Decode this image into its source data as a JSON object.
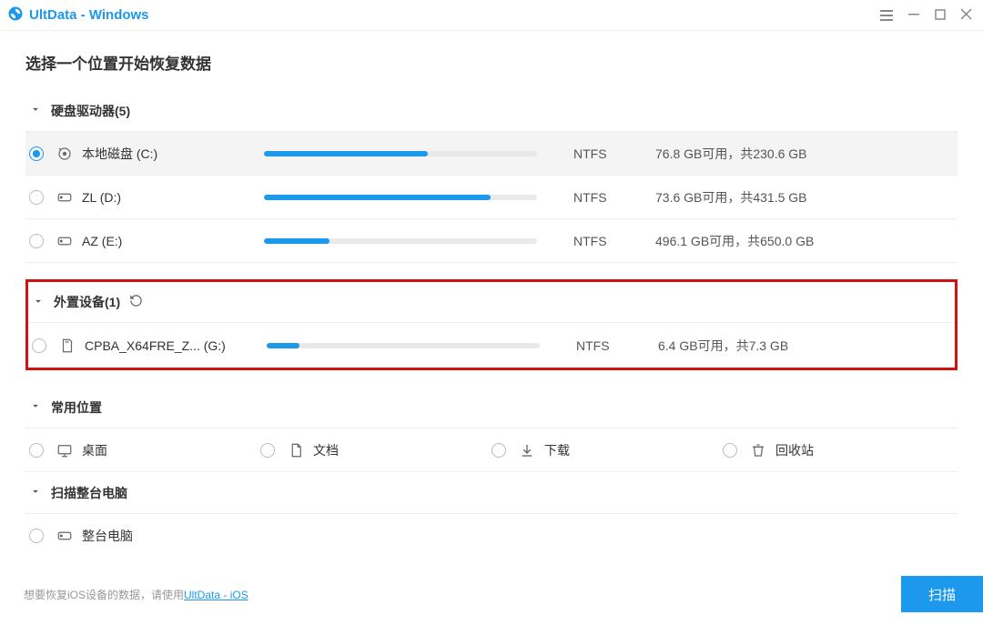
{
  "app_title": "UltData - Windows",
  "page_title": "选择一个位置开始恢复数据",
  "sections": {
    "drives_header": "硬盘驱动器(5)",
    "external_header": "外置设备(1)",
    "common_header": "常用位置",
    "whole_header": "扫描整台电脑"
  },
  "drives": [
    {
      "name": "本地磁盘 (C:)",
      "fs": "NTFS",
      "avail": "76.8 GB可用，共230.6 GB",
      "pct": 60,
      "selected": true
    },
    {
      "name": "ZL (D:)",
      "fs": "NTFS",
      "avail": "73.6 GB可用，共431.5 GB",
      "pct": 83
    },
    {
      "name": "AZ (E:)",
      "fs": "NTFS",
      "avail": "496.1 GB可用，共650.0 GB",
      "pct": 24
    }
  ],
  "external": [
    {
      "name": "CPBA_X64FRE_Z... (G:)",
      "fs": "NTFS",
      "avail": "6.4 GB可用，共7.3 GB",
      "pct": 12
    }
  ],
  "common": {
    "desktop": "桌面",
    "documents": "文档",
    "downloads": "下载",
    "recycle": "回收站"
  },
  "whole_pc": "整台电脑",
  "footer_text": "想要恢复iOS设备的数据，请使用",
  "footer_link": "UltData - iOS",
  "scan_label": "扫描"
}
